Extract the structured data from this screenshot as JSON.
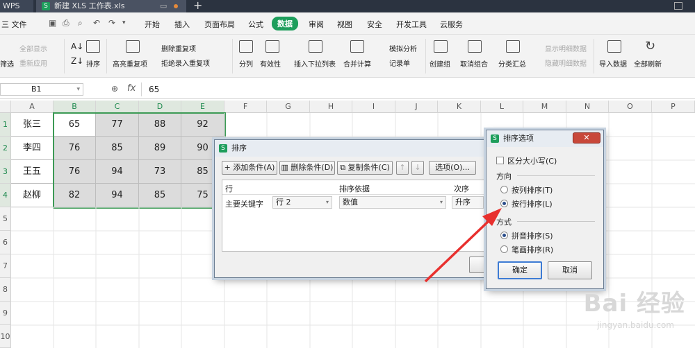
{
  "tabbar": {
    "app": "WPS",
    "doc_title": "新建 XLS 工作表.xls"
  },
  "menubar": {
    "file": "三 文件",
    "items": [
      "开始",
      "插入",
      "页面布局",
      "公式",
      "数据",
      "审阅",
      "视图",
      "安全",
      "开发工具",
      "云服务"
    ],
    "active": "数据"
  },
  "ribbon": {
    "show_all": "全部显示",
    "reapply": "重新应用",
    "filter": "筛选",
    "sort": "排序",
    "highlight_dup": "高亮重复项",
    "remove_dup": "删除重复项",
    "reject_dup": "拒绝录入重复项",
    "split": "分列",
    "validity": "有效性",
    "insert_dropdown": "插入下拉列表",
    "consolidate": "合并计算",
    "whatif": "模拟分析",
    "record": "记录单",
    "group": "创建组",
    "ungroup": "取消组合",
    "subtotal": "分类汇总",
    "show_detail": "显示明细数据",
    "hide_detail": "隐藏明细数据",
    "import": "导入数据",
    "refresh_all": "全部刷新"
  },
  "formula_bar": {
    "name_box": "B1",
    "fx": "fx",
    "value": "65"
  },
  "columns": [
    "A",
    "B",
    "C",
    "D",
    "E",
    "F",
    "G",
    "H",
    "I",
    "J",
    "K",
    "L",
    "M",
    "N",
    "O",
    "P"
  ],
  "rows": [
    "1",
    "2",
    "3",
    "4",
    "5",
    "6",
    "7",
    "8",
    "9",
    "10"
  ],
  "table": [
    {
      "name": "张三",
      "vals": [
        "65",
        "77",
        "88",
        "92"
      ]
    },
    {
      "name": "李四",
      "vals": [
        "76",
        "85",
        "89",
        "90"
      ]
    },
    {
      "name": "王五",
      "vals": [
        "76",
        "94",
        "73",
        "85"
      ]
    },
    {
      "name": "赵柳",
      "vals": [
        "82",
        "94",
        "85",
        "75"
      ]
    }
  ],
  "sort_dialog": {
    "title": "排序",
    "add": "添加条件(A)",
    "delete": "删除条件(D)",
    "copy": "复制条件(C)",
    "options": "选项(O)...",
    "hdr_row": "行",
    "hdr_basis": "排序依据",
    "hdr_order": "次序",
    "key_label": "主要关键字",
    "key_value": "行 2",
    "basis_value": "数值",
    "order_value": "升序"
  },
  "options_dialog": {
    "title": "排序选项",
    "case": "区分大小写(C)",
    "direction": "方向",
    "by_col": "按列排序(T)",
    "by_row": "按行排序(L)",
    "method": "方式",
    "pinyin": "拼音排序(S)",
    "stroke": "笔画排序(R)",
    "ok": "确定",
    "cancel": "取消"
  },
  "watermark": {
    "main": "Bai 经验",
    "sub": "jingyan.baidu.com"
  },
  "colors": {
    "accent": "#1e9e5c",
    "arrow": "#e8302e",
    "selection": "#3c9a55"
  }
}
